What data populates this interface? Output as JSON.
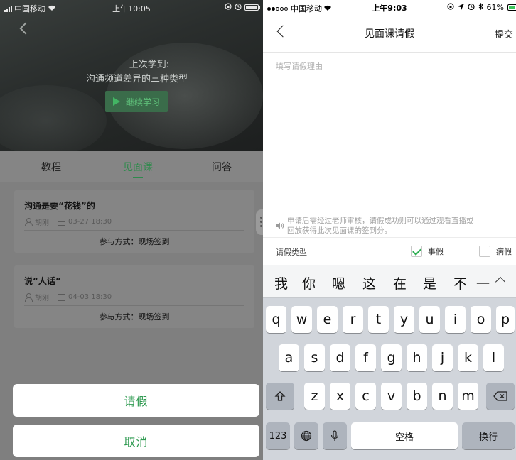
{
  "left": {
    "status": {
      "carrier": "中国移动",
      "time": "上午10:05"
    },
    "hero": {
      "last_label": "上次学到:",
      "last_course": "沟通频道差异的三种类型",
      "continue_label": "继续学习"
    },
    "tabs": [
      {
        "label": "教程"
      },
      {
        "label": "见面课"
      },
      {
        "label": "问答"
      }
    ],
    "cards": [
      {
        "title": "沟通是要“花钱”的",
        "teacher": "胡刚",
        "datetime": "03-27 18:30",
        "mode": "参与方式：现场签到"
      },
      {
        "title": "说“人话”",
        "teacher": "胡刚",
        "datetime": "04-03 18:30",
        "mode": "参与方式：现场签到"
      }
    ],
    "actions": {
      "leave": "请假",
      "cancel": "取消"
    }
  },
  "right": {
    "status": {
      "carrier": "中国移动",
      "time": "上午9:03",
      "battery": "61%"
    },
    "nav": {
      "title": "见面课请假",
      "submit": "提交"
    },
    "reason_placeholder": "填写请假理由",
    "notice_line1": "申请后需经过老师审核，请假成功则可以通过观看直播或",
    "notice_line2": "回放获得此次见面课的签到分。",
    "leave_type": {
      "label": "请假类型",
      "options": [
        {
          "label": "事假",
          "checked": true
        },
        {
          "label": "病假",
          "checked": false
        }
      ]
    },
    "keyboard": {
      "candidates": [
        "我",
        "你",
        "嗯",
        "这",
        "在",
        "是",
        "不",
        "一"
      ],
      "row1": [
        "q",
        "w",
        "e",
        "r",
        "t",
        "y",
        "u",
        "i",
        "o",
        "p"
      ],
      "row2": [
        "a",
        "s",
        "d",
        "f",
        "g",
        "h",
        "j",
        "k",
        "l"
      ],
      "row3": [
        "z",
        "x",
        "c",
        "v",
        "b",
        "n",
        "m"
      ],
      "numbers_key": "123",
      "space_key": "空格",
      "return_key": "换行"
    }
  }
}
